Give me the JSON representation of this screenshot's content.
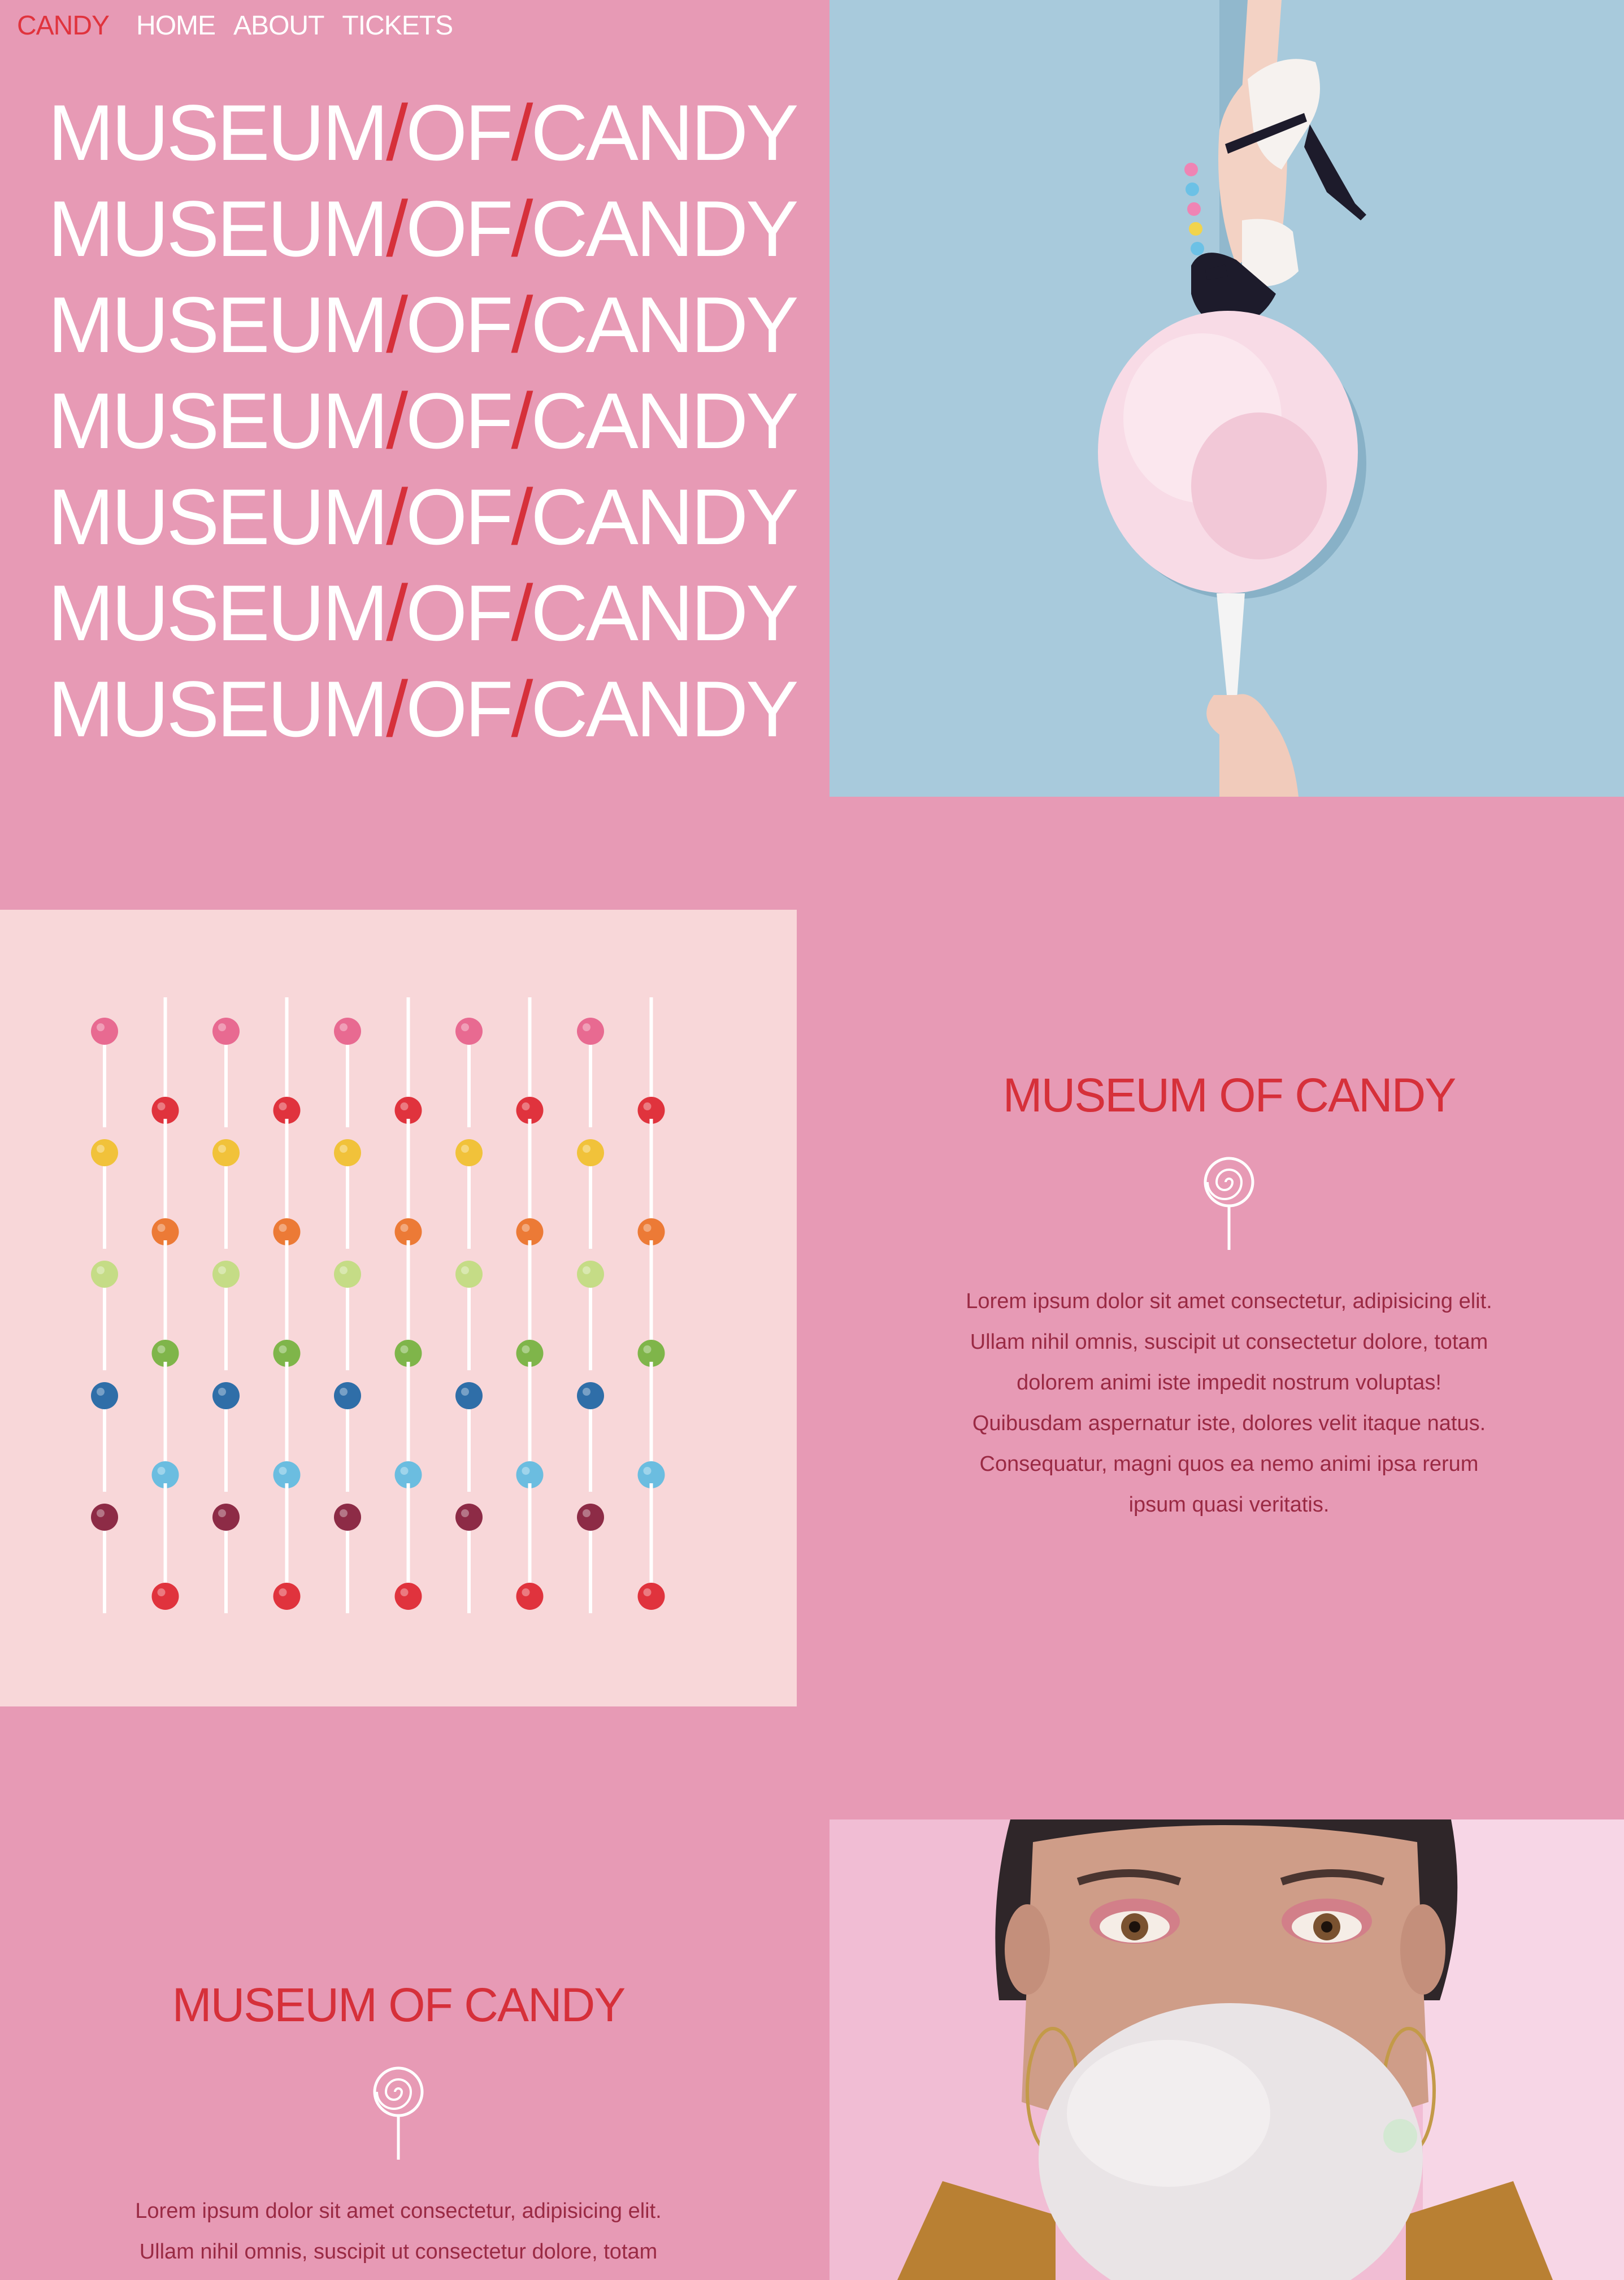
{
  "nav": {
    "brand": "CANDY",
    "links": [
      "HOME",
      "ABOUT",
      "TICKETS"
    ]
  },
  "hero": {
    "word1": "MUSEUM",
    "slash": "/",
    "word2": "OF",
    "word3": "CANDY",
    "repeat_count": 7
  },
  "section1": {
    "heading": "MUSEUM OF CANDY",
    "icon": "lollipop-icon",
    "body": "Lorem ipsum dolor sit amet consectetur, adipisicing elit. Ullam nihil omnis, suscipit ut consectetur dolore, totam dolorem animi iste impedit nostrum voluptas! Quibusdam aspernatur iste, dolores velit itaque natus. Consequatur, magni quos ea nemo animi ipsa rerum ipsum quasi veritatis."
  },
  "section2": {
    "heading": "MUSEUM OF CANDY",
    "icon": "lollipop-icon",
    "body": "Lorem ipsum dolor sit amet consectetur, adipisicing elit. Ullam nihil omnis, suscipit ut consectetur dolore, totam"
  },
  "colors": {
    "page_bg": "#e79ab5",
    "accent_red": "#d6303a",
    "sky_blue": "#a8cadc",
    "pale_pink": "#f8d7d9",
    "body_text": "#9a2a44"
  },
  "images": {
    "hero_photo": "cotton-candy-heel-photo",
    "lollipops_photo": "lollipop-grid-photo",
    "portrait_photo": "bubble-gum-portrait-photo"
  }
}
